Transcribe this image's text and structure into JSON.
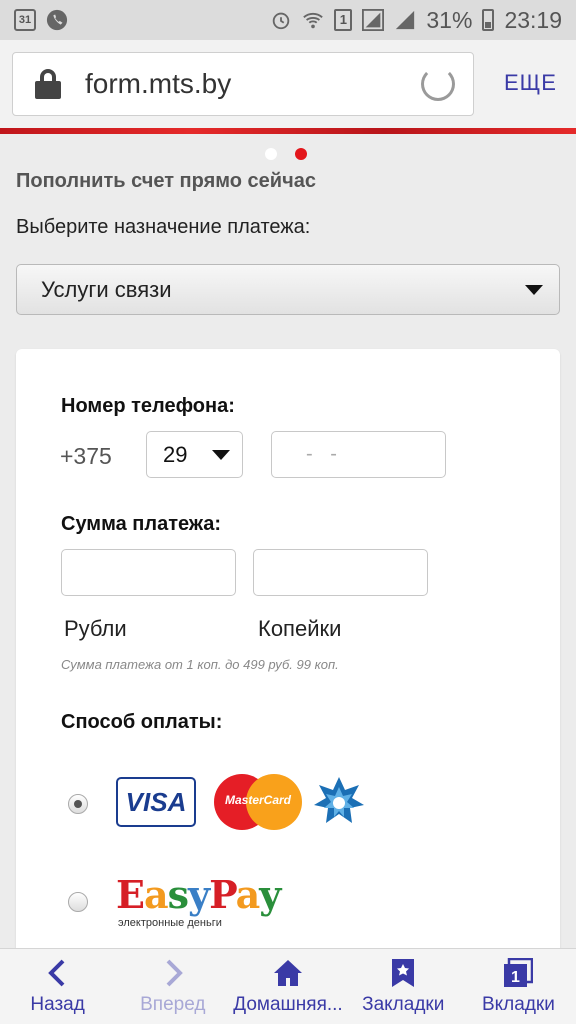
{
  "status_bar": {
    "calendar_day": "31",
    "sim_slot": "1",
    "battery": "31%",
    "time": "23:19",
    "icons": [
      "calendar-icon",
      "phone-icon",
      "alarm-icon",
      "wifi-icon",
      "sim-icon",
      "signal-icon",
      "battery-icon"
    ]
  },
  "browser": {
    "url": "form.mts.by",
    "more_label": "ЕЩЕ",
    "accent_color": "#3a3aa6"
  },
  "page": {
    "carousel_dots": 2,
    "carousel_active_index": 1,
    "heading": "Пополнить счет прямо сейчас",
    "purpose_label": "Выберите назначение платежа:",
    "purpose_value": "Услуги связи",
    "phone": {
      "label": "Номер телефона:",
      "prefix": "+375",
      "code_value": "29",
      "number_placeholder": "- -"
    },
    "amount": {
      "label": "Сумма платежа:",
      "rub_label": "Рубли",
      "kop_label": "Копейки",
      "hint": "Сумма платежа от 1 коп. до 499 руб. 99 коп."
    },
    "payment": {
      "label": "Способ оплаты:",
      "options": [
        {
          "logos": [
            "VISA",
            "MasterCard",
            "belkart-icon"
          ],
          "selected": true
        },
        {
          "logos": [
            "EasyPay"
          ],
          "selected": false
        }
      ],
      "easypay_tagline": "электронные деньги"
    },
    "brand_red": "#e3161b"
  },
  "bottom_nav": [
    {
      "label": "Назад",
      "icon": "chevron-left-icon",
      "enabled": true
    },
    {
      "label": "Вперед",
      "icon": "chevron-right-icon",
      "enabled": false
    },
    {
      "label": "Домашняя...",
      "icon": "home-icon",
      "enabled": true
    },
    {
      "label": "Закладки",
      "icon": "bookmark-icon",
      "enabled": true
    },
    {
      "label": "Вкладки",
      "icon": "tabs-icon",
      "enabled": true
    }
  ]
}
